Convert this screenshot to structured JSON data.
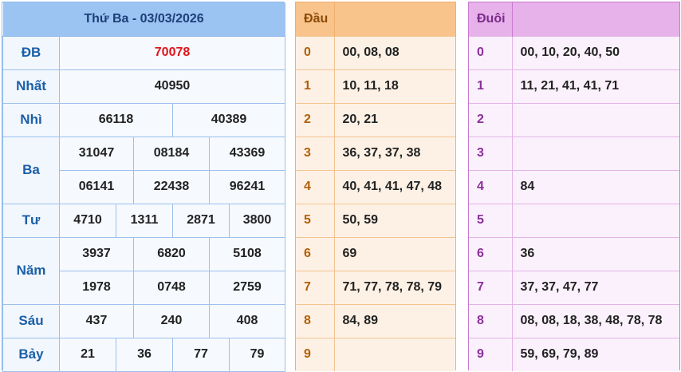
{
  "results": {
    "title": "Thứ Ba - 03/03/2026",
    "db": {
      "label": "ĐB",
      "value": "70078"
    },
    "nhat": {
      "label": "Nhất",
      "value": "40950"
    },
    "nhi": {
      "label": "Nhì",
      "values": [
        "66118",
        "40389"
      ]
    },
    "ba": {
      "label": "Ba",
      "values": [
        "31047",
        "08184",
        "43369",
        "06141",
        "22438",
        "96241"
      ]
    },
    "tu": {
      "label": "Tư",
      "values": [
        "4710",
        "1311",
        "2871",
        "3800"
      ]
    },
    "nam": {
      "label": "Năm",
      "values": [
        "3937",
        "6820",
        "5108",
        "1978",
        "0748",
        "2759"
      ]
    },
    "sau": {
      "label": "Sáu",
      "values": [
        "437",
        "240",
        "408"
      ]
    },
    "bay": {
      "label": "Bảy",
      "values": [
        "21",
        "36",
        "77",
        "79"
      ]
    }
  },
  "dau": {
    "header": "Đầu",
    "rows": [
      {
        "key": "0",
        "value": "00, 08, 08"
      },
      {
        "key": "1",
        "value": "10, 11, 18"
      },
      {
        "key": "2",
        "value": "20, 21"
      },
      {
        "key": "3",
        "value": "36, 37, 37, 38"
      },
      {
        "key": "4",
        "value": "40, 41, 41, 47, 48"
      },
      {
        "key": "5",
        "value": "50, 59"
      },
      {
        "key": "6",
        "value": "69"
      },
      {
        "key": "7",
        "value": "71, 77, 78, 78, 79"
      },
      {
        "key": "8",
        "value": "84, 89"
      },
      {
        "key": "9",
        "value": ""
      }
    ]
  },
  "duoi": {
    "header": "Đuôi",
    "rows": [
      {
        "key": "0",
        "value": "00, 10, 20, 40, 50"
      },
      {
        "key": "1",
        "value": "11, 21, 41, 41, 71"
      },
      {
        "key": "2",
        "value": ""
      },
      {
        "key": "3",
        "value": ""
      },
      {
        "key": "4",
        "value": "84"
      },
      {
        "key": "5",
        "value": ""
      },
      {
        "key": "6",
        "value": "36"
      },
      {
        "key": "7",
        "value": "37, 37, 47, 77"
      },
      {
        "key": "8",
        "value": "08, 08, 18, 38, 48, 78, 78"
      },
      {
        "key": "9",
        "value": "59, 69, 79, 89"
      }
    ]
  },
  "colors": {
    "special_prize": "#e0151b",
    "results_header": "#9cc4f2",
    "dau_header": "#f9c48b",
    "duoi_header": "#e7b2ea"
  }
}
